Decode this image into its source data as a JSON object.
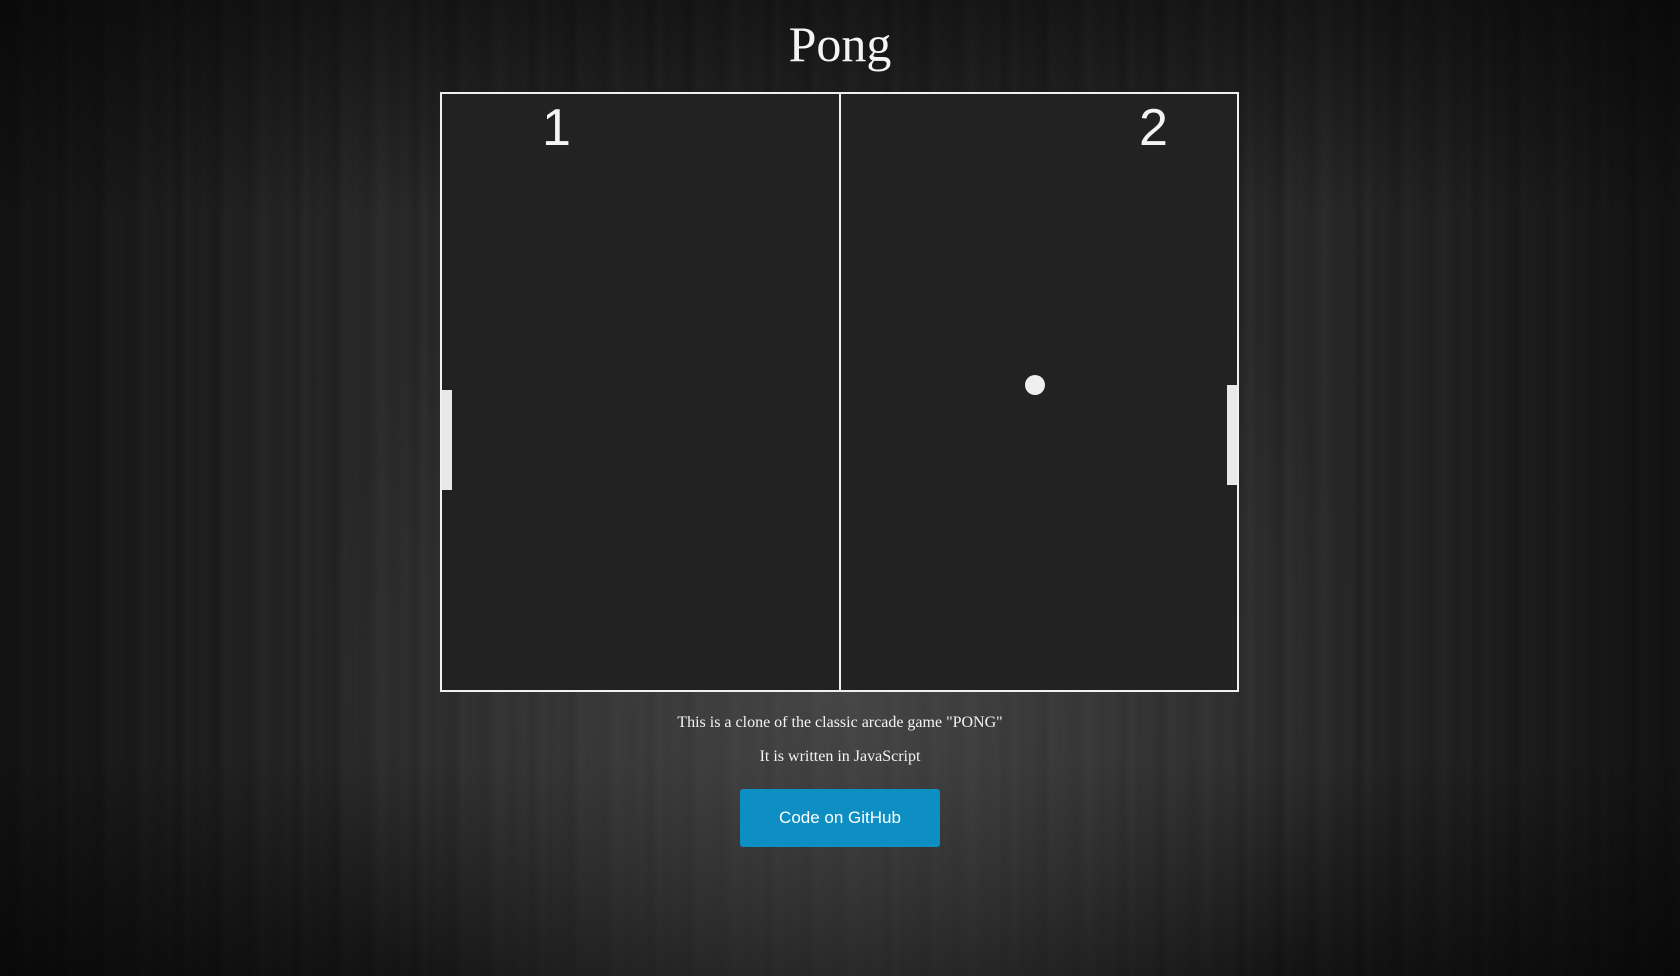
{
  "page": {
    "title": "Pong"
  },
  "game": {
    "score_left": "1",
    "score_right": "2",
    "colors": {
      "court_background": "#222222",
      "court_lines": "#f0f0f0",
      "paddles": "#e8e8e8",
      "ball": "#efefef"
    }
  },
  "description": {
    "line1": "This is a clone of the classic arcade game \"PONG\"",
    "line2": "It is written in JavaScript"
  },
  "github_button": {
    "label": "Code on GitHub",
    "color": "#0e8fc3"
  }
}
